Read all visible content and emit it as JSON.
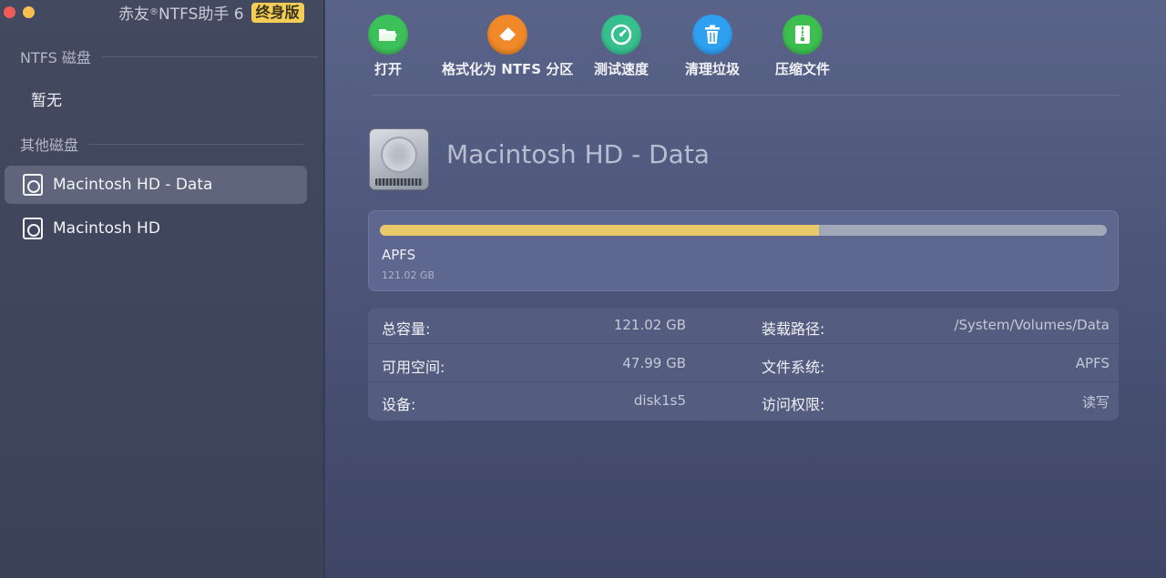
{
  "window": {
    "title": "赤友",
    "title_mark": "®",
    "title_rest": "NTFS助手 6",
    "edition_badge": "终身版"
  },
  "sidebar": {
    "ntfs_section": "NTFS 磁盘",
    "ntfs_empty": "暂无",
    "other_section": "其他磁盘",
    "disks": [
      {
        "label": "Macintosh HD - Data",
        "selected": true
      },
      {
        "label": "Macintosh HD",
        "selected": false
      }
    ]
  },
  "toolbar": {
    "items": [
      {
        "label": "打开",
        "icon": "folder-open-icon",
        "color": "#3cc05a"
      },
      {
        "label": "格式化为 NTFS 分区",
        "icon": "eraser-icon",
        "color": "#f0892a"
      },
      {
        "label": "测试速度",
        "icon": "speedometer-icon",
        "color": "#36c08e"
      },
      {
        "label": "清理垃圾",
        "icon": "trash-icon",
        "color": "#2f9ff0"
      },
      {
        "label": "压缩文件",
        "icon": "zip-file-icon",
        "color": "#3cbf4f"
      }
    ]
  },
  "volume": {
    "name": "Macintosh HD - Data",
    "filesystem": "APFS",
    "capacity": "121.02 GB",
    "used_fraction": 0.604,
    "bar_color": "#e9c96a"
  },
  "details": {
    "total_label": "总容量:",
    "total_value": "121.02 GB",
    "mount_label": "装载路径:",
    "mount_value": "/System/Volumes/Data",
    "free_label": "可用空间:",
    "free_value": "47.99 GB",
    "fs_label": "文件系统:",
    "fs_value": "APFS",
    "device_label": "设备:",
    "device_value": "disk1s5",
    "access_label": "访问权限:",
    "access_value": "读写"
  }
}
